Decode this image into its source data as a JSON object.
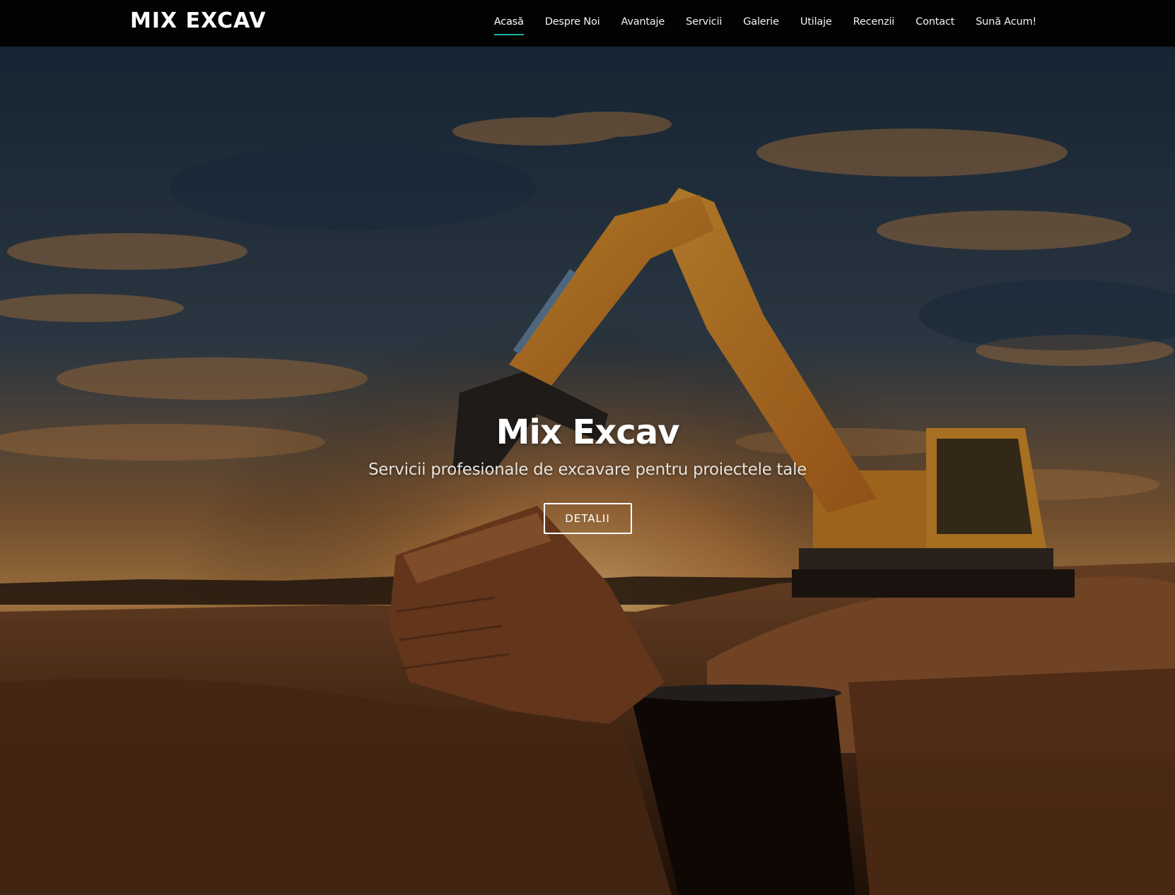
{
  "header": {
    "brand": "MIX EXCAV",
    "nav": [
      {
        "label": "Acasă",
        "active": true
      },
      {
        "label": "Despre Noi",
        "active": false
      },
      {
        "label": "Avantaje",
        "active": false
      },
      {
        "label": "Servicii",
        "active": false
      },
      {
        "label": "Galerie",
        "active": false
      },
      {
        "label": "Utilaje",
        "active": false
      },
      {
        "label": "Recenzii",
        "active": false
      },
      {
        "label": "Contact",
        "active": false
      },
      {
        "label": "Sună Acum!",
        "active": false
      }
    ]
  },
  "hero": {
    "title": "Mix Excav",
    "subtitle": "Servicii profesionale de excavare pentru proiectele tale",
    "button_label": "DETALII",
    "background_image": "excavator-at-sunset"
  },
  "colors": {
    "navbar_bg": "#030303",
    "active_underline": "#19b3a0",
    "excavator": "#e8902a"
  }
}
